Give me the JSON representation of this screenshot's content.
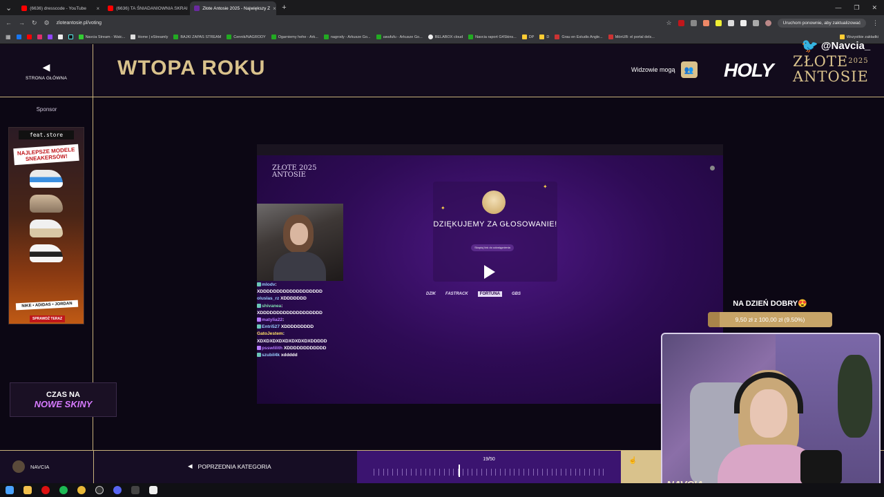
{
  "browser": {
    "tabs": [
      {
        "title": "(6636) dresscode - YouTube",
        "color": "#ff0000",
        "active": false
      },
      {
        "title": "(6636) TA ŚNIADANIOWNIA SKRAI",
        "color": "#ff0000",
        "active": false
      },
      {
        "title": "Złote Antosie 2025 - Największy Z",
        "color": "#6a2aa0",
        "active": true
      }
    ],
    "new_tab_label": "+",
    "url": "zloteantosie.pl/voting",
    "restart_label": "Uruchom ponownie, aby zaktualizować",
    "bookmarks": [
      "Navcia Stream - Watc...",
      "Home | eStreamly",
      "BAJKI ZAPAS STREAM",
      "Cennik/NAGRODY",
      "Ogarniemy hehe - Ark...",
      "nagrody - Arkusze Go...",
      "uwufufu - Arkusze Go...",
      "BELABOX cloud",
      "Navcia raport G4Skins...",
      "DP",
      "D",
      "Grau en Estudis Angle...",
      "MónUB: el portal dels...",
      "Wszystkie zakładki"
    ]
  },
  "header": {
    "home_label": "STRONA GŁÓWNA",
    "home_arrow": "◀",
    "category_title": "WTOPA ROKU",
    "viewers_label": "Widzowie mogą",
    "holy_logo": "HOLY",
    "zlote_logo_line1": "ZŁOTE",
    "zlote_logo_year": "2025",
    "zlote_logo_line2": "ANTOSIE",
    "twitter_handle": "@Navcia_"
  },
  "sidebar": {
    "sponsor_label": "Sponsor",
    "ad_store": "feat.store",
    "ad_headline": "NAJLEPSZE MODELE SNEAKERSÓW!",
    "ad_brands": "NIKE • ADIDAS • JORDAN",
    "ad_cta": "SPRAWDŹ TERAZ",
    "skins_line1": "CZAS NA",
    "skins_line2": "NOWE SKINY"
  },
  "stage": {
    "mini_logo_line1": "ZŁOTE 2025",
    "mini_logo_line2": "ANTOSIE",
    "thanks_title": "DZIĘKUJEMY ZA GŁOSOWANIE!",
    "copy_button": "Skopiuj link do udostępnienia",
    "partners": [
      "DZIK",
      "FASTRACK",
      "FORTUNA",
      "GBS"
    ],
    "chat": [
      {
        "user": "mlodv",
        "text": ":",
        "cls": "u"
      },
      {
        "user": "",
        "text": "XDDDDDDDDDDDDDDDDDDD",
        "cls": ""
      },
      {
        "user": "oluslas_rz",
        "text": "XDDDDDDD",
        "cls": "u"
      },
      {
        "user": "shivanea",
        "text": ":",
        "cls": "u3"
      },
      {
        "user": "",
        "text": "XDDDDDDDDDDDDDDDDDDD",
        "cls": ""
      },
      {
        "user": "matylia22",
        "text": ":",
        "cls": "u2"
      },
      {
        "user": "Entri527",
        "text": "XDDDDDDDDD",
        "cls": "u"
      },
      {
        "user": "GatoJestem",
        "text": ":",
        "cls": "u4"
      },
      {
        "user": "",
        "text": "XDXDXDXDXDXDXDXDXDDDDD",
        "cls": ""
      },
      {
        "user": "psswlilith",
        "text": "XDDDDDDDDDDDD",
        "cls": "u2"
      },
      {
        "user": "szubil4k",
        "text": "xddddd",
        "cls": "u"
      }
    ]
  },
  "donation": {
    "title": "NA DZIEŃ DOBRY😍",
    "amount_text": "9,50 zł z 100,00 zł (9.50%)",
    "progress": 0.095
  },
  "webcam": {
    "name": "NAVCIA"
  },
  "footer": {
    "username": "NAVCIA",
    "prev_label": "POPRZEDNIA KATEGORIA",
    "prev_arrow": "◀",
    "counter": "19/50",
    "current": 19,
    "total": 50
  },
  "colors": {
    "gold": "#d9c28c",
    "purple_bg": "#3b1470"
  }
}
